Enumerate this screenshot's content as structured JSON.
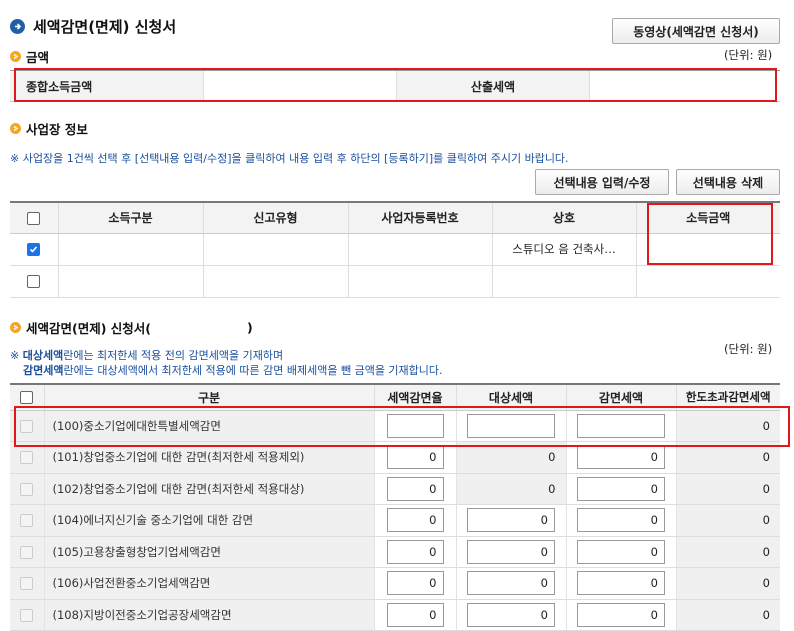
{
  "header": {
    "title": "세액감면(면제) 신청서",
    "video_button": "동영상(세액감면 신청서)"
  },
  "amount_section": {
    "title": "금액",
    "unit": "(단위: 원)",
    "total_income_label": "종합소득금액",
    "total_income_value": "",
    "calculated_tax_label": "산출세액",
    "calculated_tax_value": ""
  },
  "business_section": {
    "title": "사업장 정보",
    "note": "※ 사업장을 1건씩 선택 후 [선택내용 입력/수정]을 클릭하여 내용 입력 후 하단의 [등록하기]를 클릭하여 주시기 바랍니다.",
    "edit_button": "선택내용 입력/수정",
    "delete_button": "선택내용 삭제",
    "columns": [
      "소득구분",
      "신고유형",
      "사업자등록번호",
      "상호",
      "소득금액"
    ],
    "rows": [
      {
        "checked": true,
        "income_type": "",
        "report_type": "",
        "biz_no": "",
        "name": "스튜디오 음 건축사…",
        "income": ""
      },
      {
        "checked": false,
        "income_type": "",
        "report_type": "",
        "biz_no": "",
        "name": "",
        "income": ""
      }
    ]
  },
  "reduction_section": {
    "title": "세액감면(면제) 신청서(",
    "title_close": ")",
    "unit": "(단위: 원)",
    "note1_bold": "대상세액",
    "note1_rest": "란에는 최저한세 적용 전의 감면세액을 기재하며",
    "note2_bold": "감면세액",
    "note2_rest": "란에는 대상세액에서 최저한세 적용에 따른 감면 배제세액을 뺀 금액을 기재합니다.",
    "note_prefix": "※ ",
    "columns": [
      "구분",
      "세액감면율",
      "대상세액",
      "감면세액",
      "한도초과감면세액"
    ],
    "rows": [
      {
        "name": "(100)중소기업에대한특별세액감면",
        "rate": "",
        "target": "",
        "target_input": true,
        "reduced": "",
        "excess": "0"
      },
      {
        "name": "(101)창업중소기업에 대한 감면(최저한세 적용제외)",
        "rate": "0",
        "target": "0",
        "target_input": false,
        "reduced": "0",
        "excess": "0"
      },
      {
        "name": "(102)창업중소기업에 대한 감면(최저한세 적용대상)",
        "rate": "0",
        "target": "0",
        "target_input": false,
        "reduced": "0",
        "excess": "0"
      },
      {
        "name": "(104)에너지신기술 중소기업에 대한 감면",
        "rate": "0",
        "target": "0",
        "target_input": true,
        "reduced": "0",
        "excess": "0"
      },
      {
        "name": "(105)고용창출형창업기업세액감면",
        "rate": "0",
        "target": "0",
        "target_input": true,
        "reduced": "0",
        "excess": "0"
      },
      {
        "name": "(106)사업전환중소기업세액감면",
        "rate": "0",
        "target": "0",
        "target_input": true,
        "reduced": "0",
        "excess": "0"
      },
      {
        "name": "(108)지방이전중소기업공장세액감면",
        "rate": "0",
        "target": "0",
        "target_input": true,
        "reduced": "0",
        "excess": "0"
      }
    ]
  }
}
